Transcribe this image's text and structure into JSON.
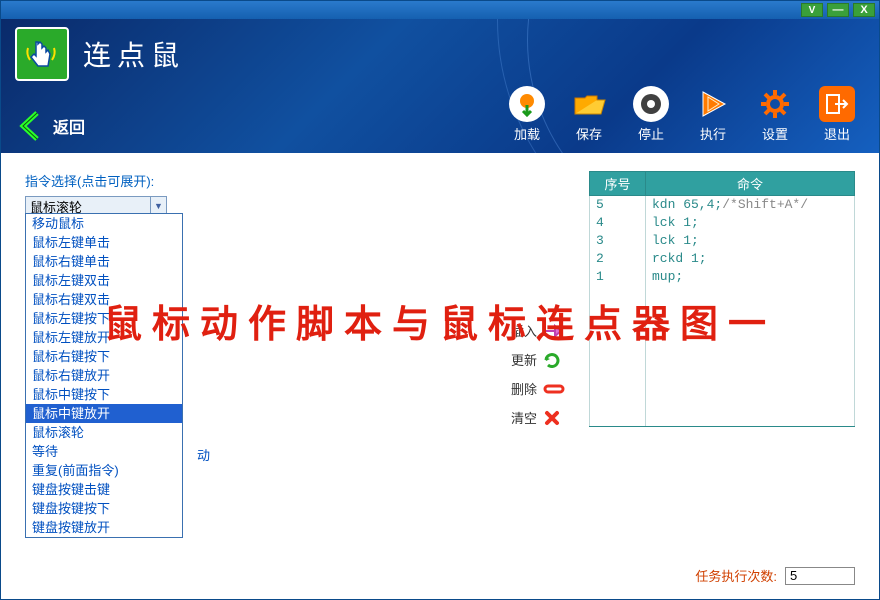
{
  "titlebar": {
    "v": "V",
    "min": "—",
    "close": "X"
  },
  "app": {
    "title": "连点鼠"
  },
  "nav": {
    "back": "返回"
  },
  "tools": {
    "load": "加载",
    "save": "保存",
    "stop": "停止",
    "run": "执行",
    "settings": "设置",
    "exit": "退出"
  },
  "selector": {
    "label": "指令选择(点击可展开):",
    "value": "鼠标滚轮",
    "peek": "动",
    "items": [
      "移动鼠标",
      "鼠标左键单击",
      "鼠标右键单击",
      "鼠标左键双击",
      "鼠标右键双击",
      "鼠标左键按下",
      "鼠标左键放开",
      "鼠标右键按下",
      "鼠标右键放开",
      "鼠标中键按下",
      "鼠标中键放开",
      "鼠标滚轮",
      "等待",
      "重复(前面指令)",
      "键盘按键击键",
      "键盘按键按下",
      "键盘按键放开"
    ],
    "selected_index": 10
  },
  "mid": {
    "item0": "",
    "item1": "",
    "insert": "插入",
    "update": "更新",
    "delete": "删除",
    "clear": "清空"
  },
  "table": {
    "h1": "序号",
    "h2": "命令",
    "rows": [
      {
        "n": "5",
        "cmd": "kdn 65,4;",
        "cmt": "/*Shift+A*/"
      },
      {
        "n": "4",
        "cmd": "lck 1;",
        "cmt": ""
      },
      {
        "n": "3",
        "cmd": "lck 1;",
        "cmt": ""
      },
      {
        "n": "2",
        "cmd": "rckd 1;",
        "cmt": ""
      },
      {
        "n": "1",
        "cmd": "mup;",
        "cmt": ""
      },
      {
        "n": "",
        "cmd": "",
        "cmt": ""
      }
    ]
  },
  "exec": {
    "label": "任务执行次数:",
    "value": "5"
  },
  "watermark": "鼠标动作脚本与鼠标连点器图一"
}
